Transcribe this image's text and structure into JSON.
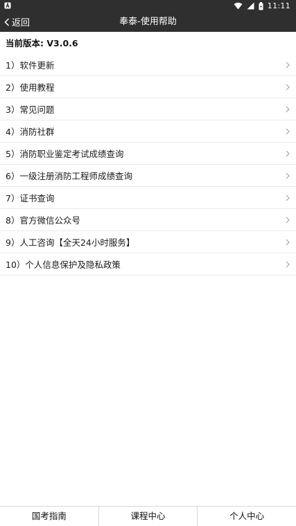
{
  "status_bar": {
    "time": "11:11",
    "left_icon": "notification-a-icon",
    "icons": [
      "wifi-icon",
      "signal-icon",
      "battery-icon"
    ]
  },
  "nav": {
    "back_label": "返回",
    "title": "奉泰-使用帮助"
  },
  "version_label": "当前版本: V3.0.6",
  "menu": [
    {
      "label": "1）软件更新"
    },
    {
      "label": "2）使用教程"
    },
    {
      "label": "3）常见问题"
    },
    {
      "label": "4）消防社群"
    },
    {
      "label": "5）消防职业鉴定考试成绩查询"
    },
    {
      "label": "6）一级注册消防工程师成绩查询"
    },
    {
      "label": "7）证书查询"
    },
    {
      "label": "8）官方微信公众号"
    },
    {
      "label": "9）人工咨询【全天24小时服务】"
    },
    {
      "label": "10）个人信息保护及隐私政策"
    }
  ],
  "tabs": [
    {
      "label": "国考指南"
    },
    {
      "label": "课程中心"
    },
    {
      "label": "个人中心"
    }
  ],
  "colors": {
    "header_bg": "#2f2f2f",
    "divider": "#e9e9e9",
    "chevron": "#9a9a9a"
  }
}
